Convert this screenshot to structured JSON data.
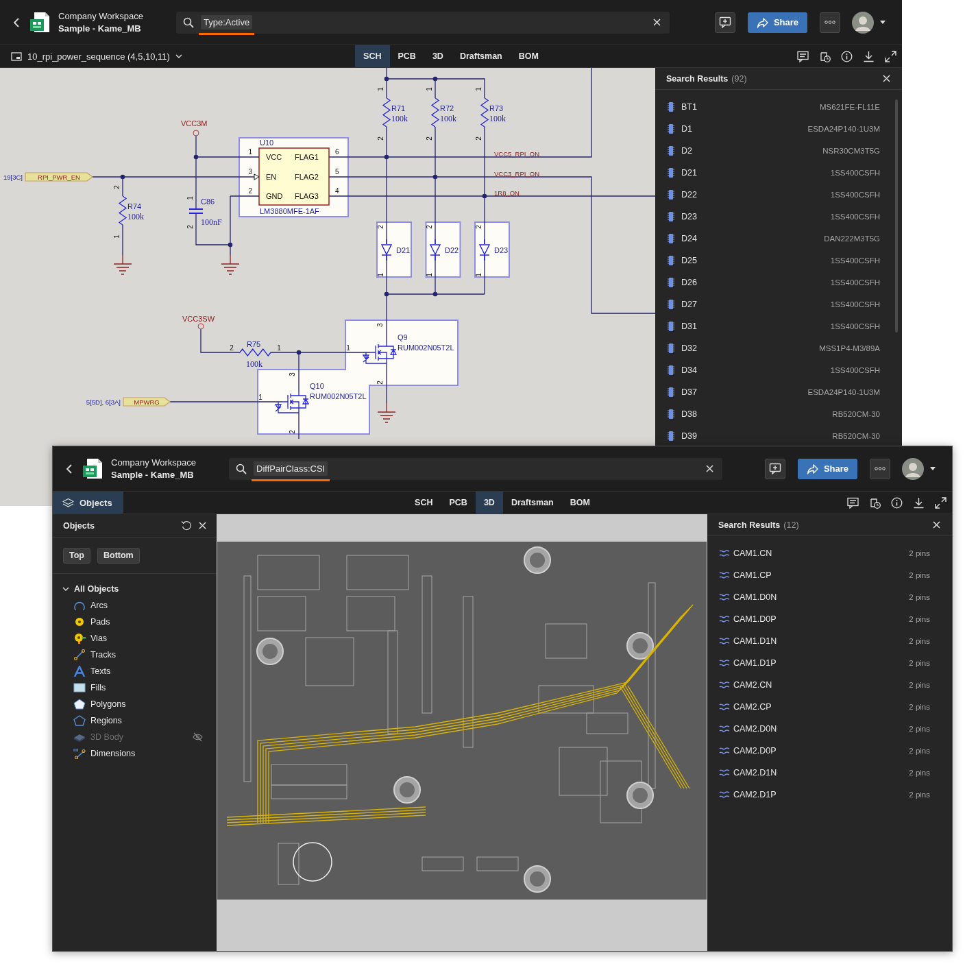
{
  "windows": [
    {
      "header": {
        "workspace": "Company Workspace",
        "project": "Sample - Kame_MB",
        "search_filter": "Type:Active",
        "share": "Share"
      },
      "toolbar": {
        "document": "10_rpi_power_sequence (4,5,10,11)",
        "tabs": [
          {
            "label": "SCH",
            "selected": true
          },
          {
            "label": "PCB",
            "selected": false
          },
          {
            "label": "3D",
            "selected": false
          },
          {
            "label": "Draftsman",
            "selected": false
          },
          {
            "label": "BOM",
            "selected": false
          }
        ]
      },
      "schematic": {
        "power_ports": [
          "VCC3M",
          "VCC3SW"
        ],
        "ports": [
          {
            "reference": "19[3C]",
            "name": "RPI_PWR_EN"
          },
          {
            "reference": "5[5D], 6[3A]",
            "name": "MPWRG"
          }
        ],
        "ic": {
          "designator": "U10",
          "part": "LM3880MFE-1AF",
          "pins": [
            {
              "number": "1",
              "name": "VCC"
            },
            {
              "number": "3",
              "name": "EN"
            },
            {
              "number": "2",
              "name": "GND"
            },
            {
              "number": "6",
              "name": "FLAG1"
            },
            {
              "number": "5",
              "name": "FLAG2"
            },
            {
              "number": "4",
              "name": "FLAG3"
            }
          ]
        },
        "net_labels": [
          "VCC5_RPI_ON",
          "VCC3_RPI_ON",
          "1R8_ON"
        ],
        "resistors": [
          {
            "designator": "R71",
            "value": "100k",
            "pins": [
              "1",
              "2"
            ]
          },
          {
            "designator": "R72",
            "value": "100k",
            "pins": [
              "1",
              "2"
            ]
          },
          {
            "designator": "R73",
            "value": "100k",
            "pins": [
              "1",
              "2"
            ]
          },
          {
            "designator": "R74",
            "value": "100k",
            "pins": [
              "2",
              "1"
            ]
          },
          {
            "designator": "R75",
            "value": "100k",
            "pins": [
              "2",
              "1"
            ]
          }
        ],
        "capacitors": [
          {
            "designator": "C86",
            "value": "100nF",
            "pins": [
              "1",
              "2"
            ]
          }
        ],
        "diodes": [
          {
            "designator": "D21",
            "pins": [
              "2",
              "1"
            ]
          },
          {
            "designator": "D22",
            "pins": [
              "2",
              "1"
            ]
          },
          {
            "designator": "D23",
            "pins": [
              "2",
              "1"
            ]
          }
        ],
        "transistors": [
          {
            "designator": "Q9",
            "part": "RUM002N05T2L",
            "pins": [
              "3",
              "1",
              "2"
            ]
          },
          {
            "designator": "Q10",
            "part": "RUM002N05T2L",
            "pins": [
              "3",
              "1",
              "2"
            ]
          }
        ]
      },
      "search_results": {
        "title": "Search Results",
        "count": "(92)",
        "kind": "component",
        "items": [
          {
            "name": "BT1",
            "detail": "MS621FE-FL11E"
          },
          {
            "name": "D1",
            "detail": "ESDA24P140-1U3M"
          },
          {
            "name": "D2",
            "detail": "NSR30CM3T5G"
          },
          {
            "name": "D21",
            "detail": "1SS400CSFH"
          },
          {
            "name": "D22",
            "detail": "1SS400CSFH"
          },
          {
            "name": "D23",
            "detail": "1SS400CSFH"
          },
          {
            "name": "D24",
            "detail": "DAN222M3T5G"
          },
          {
            "name": "D25",
            "detail": "1SS400CSFH"
          },
          {
            "name": "D26",
            "detail": "1SS400CSFH"
          },
          {
            "name": "D27",
            "detail": "1SS400CSFH"
          },
          {
            "name": "D31",
            "detail": "1SS400CSFH"
          },
          {
            "name": "D32",
            "detail": "MSS1P4-M3/89A"
          },
          {
            "name": "D34",
            "detail": "1SS400CSFH"
          },
          {
            "name": "D37",
            "detail": "ESDA24P140-1U3M"
          },
          {
            "name": "D38",
            "detail": "RB520CM-30"
          },
          {
            "name": "D39",
            "detail": "RB520CM-30"
          }
        ]
      }
    },
    {
      "header": {
        "workspace": "Company Workspace",
        "project": "Sample - Kame_MB",
        "search_filter": "DiffPairClass:CSI",
        "share": "Share"
      },
      "toolbar": {
        "objects_button": {
          "label": "Objects",
          "selected": true
        },
        "tabs": [
          {
            "label": "SCH",
            "selected": false
          },
          {
            "label": "PCB",
            "selected": false
          },
          {
            "label": "3D",
            "selected": true
          },
          {
            "label": "Draftsman",
            "selected": false
          },
          {
            "label": "BOM",
            "selected": false
          }
        ]
      },
      "objects_panel": {
        "title": "Objects",
        "layer_buttons": [
          "Top",
          "Bottom"
        ],
        "tree": {
          "label": "All Objects",
          "expanded": true,
          "children": [
            {
              "label": "Arcs",
              "kind": "arcs",
              "hidden": false
            },
            {
              "label": "Pads",
              "kind": "pads",
              "hidden": false
            },
            {
              "label": "Vias",
              "kind": "vias",
              "hidden": false
            },
            {
              "label": "Tracks",
              "kind": "tracks",
              "hidden": false
            },
            {
              "label": "Texts",
              "kind": "texts",
              "hidden": false
            },
            {
              "label": "Fills",
              "kind": "fills",
              "hidden": false
            },
            {
              "label": "Polygons",
              "kind": "polygons",
              "hidden": false
            },
            {
              "label": "Regions",
              "kind": "regions",
              "hidden": false
            },
            {
              "label": "3D Body",
              "kind": "body3d",
              "hidden": true
            },
            {
              "label": "Dimensions",
              "kind": "dimensions",
              "hidden": false
            }
          ]
        }
      },
      "search_results": {
        "title": "Search Results",
        "count": "(12)",
        "kind": "diff_pair",
        "items": [
          {
            "name": "CAM1.CN",
            "detail": "2 pins"
          },
          {
            "name": "CAM1.CP",
            "detail": "2 pins"
          },
          {
            "name": "CAM1.D0N",
            "detail": "2 pins"
          },
          {
            "name": "CAM1.D0P",
            "detail": "2 pins"
          },
          {
            "name": "CAM1.D1N",
            "detail": "2 pins"
          },
          {
            "name": "CAM1.D1P",
            "detail": "2 pins"
          },
          {
            "name": "CAM2.CN",
            "detail": "2 pins"
          },
          {
            "name": "CAM2.CP",
            "detail": "2 pins"
          },
          {
            "name": "CAM2.D0N",
            "detail": "2 pins"
          },
          {
            "name": "CAM2.D0P",
            "detail": "2 pins"
          },
          {
            "name": "CAM2.D1N",
            "detail": "2 pins"
          },
          {
            "name": "CAM2.D1P",
            "detail": "2 pins"
          }
        ]
      }
    }
  ]
}
